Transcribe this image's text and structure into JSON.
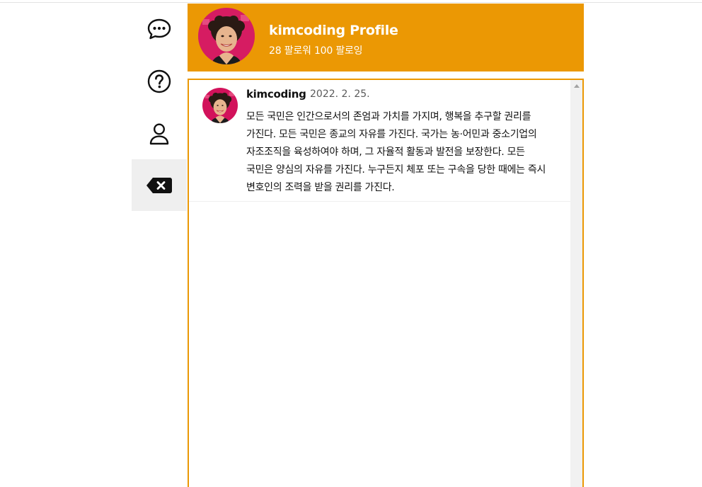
{
  "sidebar": {
    "items": [
      {
        "icon": "chat-bubble-icon"
      },
      {
        "icon": "question-circle-icon"
      },
      {
        "icon": "user-icon"
      },
      {
        "icon": "backspace-icon"
      }
    ]
  },
  "profile": {
    "title": "kimcoding Profile",
    "stats": "28 팔로워 100 팔로잉",
    "accent_color": "#eb9804"
  },
  "tweets": [
    {
      "username": "kimcoding",
      "date": "2022. 2. 25.",
      "content": "모든 국민은 인간으로서의 존엄과 가치를 가지며, 행복을 추구할 권리를 가진다. 모든 국민은 종교의 자유를 가진다. 국가는 농·어민과 중소기업의 자조조직을 육성하여야 하며, 그 자율적 활동과 발전을 보장한다. 모든 국민은 양심의 자유를 가진다. 누구든지 체포 또는 구속을 당한 때에는 즉시 변호인의 조력을 받을 권리를 가진다."
    }
  ]
}
